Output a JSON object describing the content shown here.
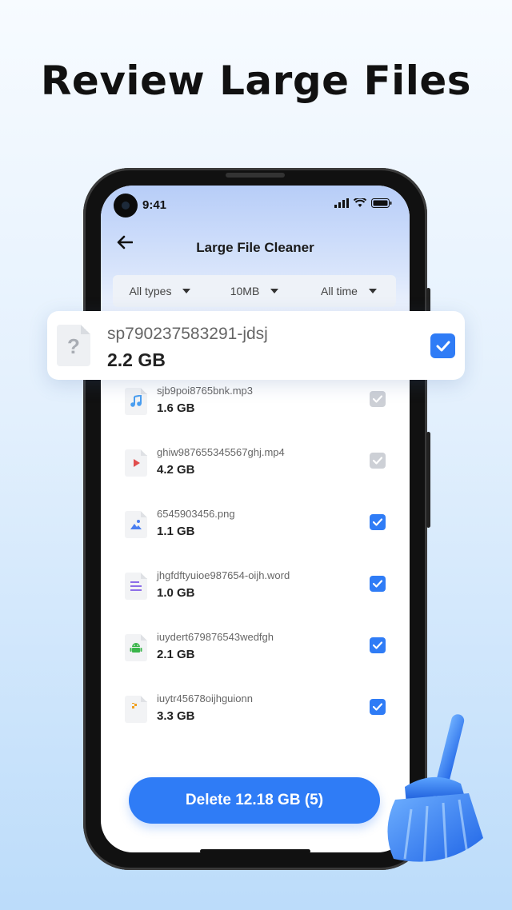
{
  "headline": "Review Large Files",
  "status_bar": {
    "time": "9:41",
    "icons": [
      "signal-icon",
      "wifi-icon",
      "battery-icon"
    ]
  },
  "app_bar": {
    "title": "Large File Cleaner",
    "back_icon": "arrow-left-icon"
  },
  "filters": [
    {
      "label": "All types"
    },
    {
      "label": "10MB"
    },
    {
      "label": "All time"
    }
  ],
  "highlighted_file": {
    "name": "sp790237583291-jdsj",
    "size": "2.2 GB",
    "icon": "unknown-file-icon",
    "checked": true
  },
  "files": [
    {
      "name": "sjb9poi8765bnk.mp3",
      "size": "1.6 GB",
      "icon": "music-icon",
      "checked": false
    },
    {
      "name": "ghiw987655345567ghj.mp4",
      "size": "4.2 GB",
      "icon": "video-icon",
      "checked": false
    },
    {
      "name": "6545903456.png",
      "size": "1.1 GB",
      "icon": "image-icon",
      "checked": true
    },
    {
      "name": "jhgfdftyuioe987654-oijh.word",
      "size": "1.0 GB",
      "icon": "document-icon",
      "checked": true
    },
    {
      "name": "iuydert679876543wedfgh",
      "size": "2.1 GB",
      "icon": "android-icon",
      "checked": true
    },
    {
      "name": "iuytr45678oijhguionn",
      "size": "3.3 GB",
      "icon": "zip-icon",
      "checked": true
    }
  ],
  "delete_button": {
    "label": "Delete 12.18 GB (5)"
  },
  "colors": {
    "accent": "#2f7cf6",
    "unchecked": "#cdd0d6"
  }
}
